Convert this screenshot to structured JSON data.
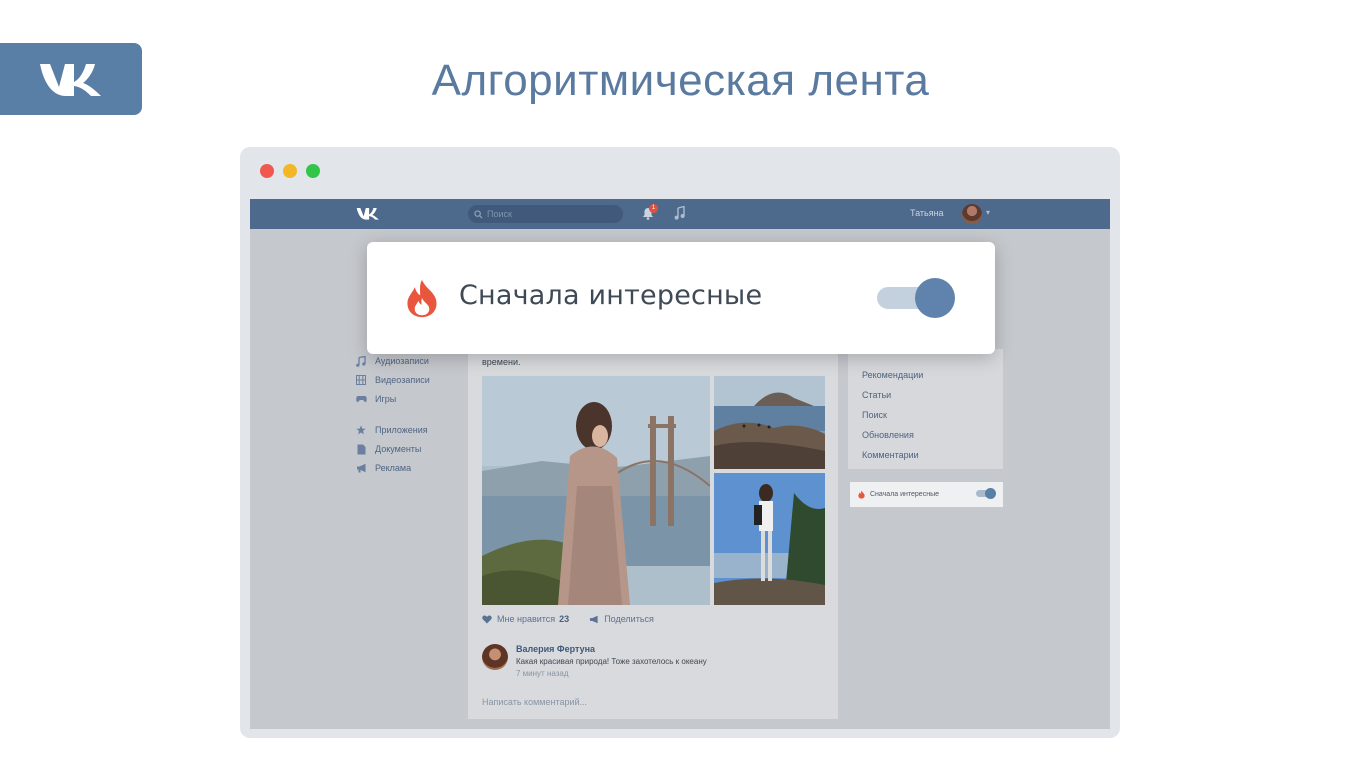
{
  "slide": {
    "title": "Алгоритмическая лента"
  },
  "header": {
    "search_placeholder": "Поиск",
    "notification_count": "1",
    "user_name": "Татьяна"
  },
  "sidebar": {
    "items": [
      {
        "label": "Аудиозаписи",
        "icon": "music-note-icon"
      },
      {
        "label": "Видеозаписи",
        "icon": "film-icon"
      },
      {
        "label": "Игры",
        "icon": "gamepad-icon"
      },
      {
        "label": "Приложения",
        "icon": "star-icon"
      },
      {
        "label": "Документы",
        "icon": "document-icon"
      },
      {
        "label": "Реклама",
        "icon": "megaphone-icon"
      }
    ]
  },
  "post": {
    "text": "времени.",
    "like_label": "Мне нравится",
    "like_count": "23",
    "share_label": "Поделиться",
    "comment": {
      "author": "Валерия Фертуна",
      "text": "Какая красивая природа! Тоже захотелось к океану",
      "time": "7 минут назад"
    },
    "write_comment_placeholder": "Написать комментарий..."
  },
  "right_menu": {
    "items": [
      "Рекомендации",
      "Статьи",
      "Поиск",
      "Обновления",
      "Комментарии"
    ]
  },
  "toggle": {
    "label": "Сначала интересные",
    "enabled": true,
    "icon": "fire-icon"
  },
  "colors": {
    "brand": "#5a7fa6",
    "header": "#4d6a8d",
    "fire": "#e8573d",
    "toggle_knob": "#5f83ad"
  }
}
